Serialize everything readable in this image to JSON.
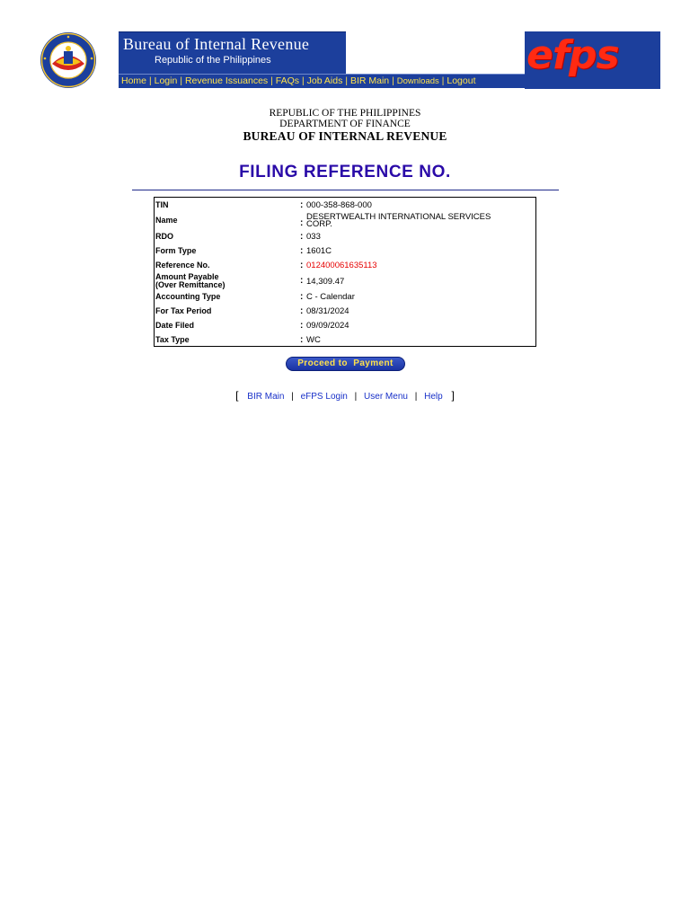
{
  "banner": {
    "org_name": "Bureau of Internal Revenue",
    "org_sub": "Republic of the Philippines",
    "seal_icon": "bir-seal-icon",
    "efps_logo": "efps",
    "colors": {
      "banner_blue": "#1c3f9c",
      "nav_yellow": "#ffe24a",
      "efps_red": "#ff2a12"
    },
    "nav": [
      {
        "label": "Home"
      },
      {
        "label": "Login"
      },
      {
        "label": "Revenue Issuances"
      },
      {
        "label": "FAQs"
      },
      {
        "label": "Job Aids"
      },
      {
        "label": "BIR Main"
      },
      {
        "label": "Downloads"
      },
      {
        "label": "Logout"
      }
    ]
  },
  "header": {
    "line1": "REPUBLIC OF THE PHILIPPINES",
    "line2": "DEPARTMENT OF FINANCE",
    "line3": "BUREAU OF INTERNAL REVENUE"
  },
  "page_title": "FILING REFERENCE NO.",
  "info": {
    "tin": {
      "label": "TIN",
      "value": "000-358-868-000"
    },
    "name": {
      "label": "Name",
      "value_line1": "DESERTWEALTH INTERNATIONAL SERVICES",
      "value_line2": "CORP."
    },
    "rdo": {
      "label": "RDO",
      "value": "033"
    },
    "form_type": {
      "label": "Form Type",
      "value": "1601C"
    },
    "reference_no": {
      "label": "Reference No.",
      "value": "012400061635113"
    },
    "amount_payable": {
      "label_line1": "Amount Payable",
      "label_line2": "(Over Remittance)",
      "value": "14,309.47"
    },
    "accounting_type": {
      "label": "Accounting Type",
      "value": "C - Calendar"
    },
    "tax_period": {
      "label": "For Tax Period",
      "value": "08/31/2024"
    },
    "date_filed": {
      "label": "Date Filed",
      "value": "09/09/2024"
    },
    "tax_type": {
      "label": "Tax Type",
      "value": "WC"
    },
    "colon": ":"
  },
  "proceed_button": "Proceed to  Payment",
  "bottom_links": {
    "open_bracket": "[",
    "close_bracket": "]",
    "separator": "|",
    "items": [
      {
        "label": "BIR Main"
      },
      {
        "label": "eFPS Login"
      },
      {
        "label": "User Menu"
      },
      {
        "label": "Help"
      }
    ]
  }
}
